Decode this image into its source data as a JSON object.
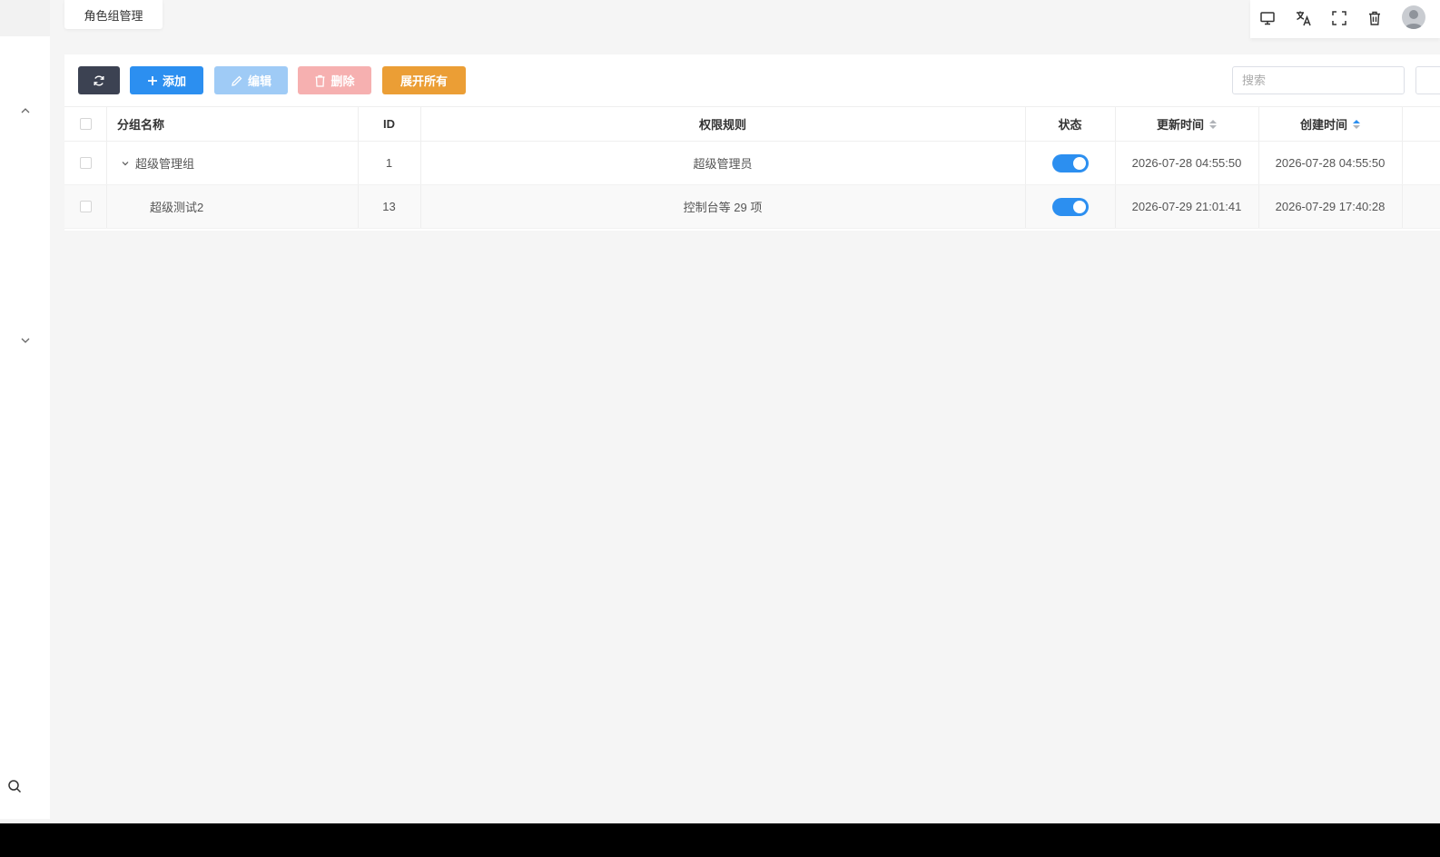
{
  "tab": {
    "label": "角色组管理"
  },
  "toolbar": {
    "add_label": "添加",
    "edit_label": "编辑",
    "delete_label": "删除",
    "expand_label": "展开所有"
  },
  "search": {
    "placeholder": "搜索"
  },
  "table": {
    "headers": {
      "name": "分组名称",
      "id": "ID",
      "rules": "权限规则",
      "status": "状态",
      "updated": "更新时间",
      "created": "创建时间"
    },
    "rows": [
      {
        "name": "超级管理组",
        "id": "1",
        "rules": "超级管理员",
        "status": "on",
        "updated": "2026-07-28 04:55:50",
        "created": "2026-07-28 04:55:50",
        "expanded": true
      },
      {
        "name": "超级测试2",
        "id": "13",
        "rules": "控制台等 29 项",
        "status": "on",
        "updated": "2026-07-29 21:01:41",
        "created": "2026-07-29 17:40:28"
      }
    ]
  },
  "icons": {
    "rail": [
      "chevron-up-icon",
      "chevron-down-icon",
      "search-icon"
    ],
    "topbar": [
      "monitor-icon",
      "translate-icon",
      "fullscreen-icon",
      "trash-icon",
      "avatar"
    ],
    "toolbar": [
      "refresh-icon",
      "plus-icon",
      "pencil-icon",
      "trash-icon"
    ]
  },
  "colors": {
    "primary": "#2c8ff0",
    "dark": "#3c4252",
    "warning": "#eb9e35",
    "danger_disabled": "#f6b0b0",
    "primary_disabled": "#9fcbf6"
  }
}
